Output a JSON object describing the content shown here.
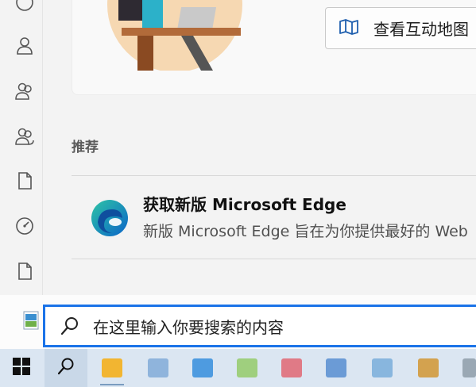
{
  "main": {
    "map_button_label": "查看互动地图",
    "section_title": "推荐",
    "recommendation": {
      "title": "获取新版 Microsoft Edge",
      "description": "新版 Microsoft Edge 旨在为你提供最好的 Web"
    }
  },
  "search": {
    "placeholder": "在这里输入你要搜索的内容"
  },
  "rail_icons": [
    "person-icon",
    "people-icon",
    "people-group-icon",
    "document-icon",
    "gauge-icon",
    "document-icon"
  ],
  "taskbar_apps": [
    "file-explorer-icon",
    "app-icon",
    "app-icon",
    "app-icon",
    "app-icon",
    "app-icon",
    "app-icon",
    "app-icon",
    "app-icon"
  ],
  "colors": {
    "accent": "#1a73e8",
    "taskbar": "#dbe6f2"
  }
}
